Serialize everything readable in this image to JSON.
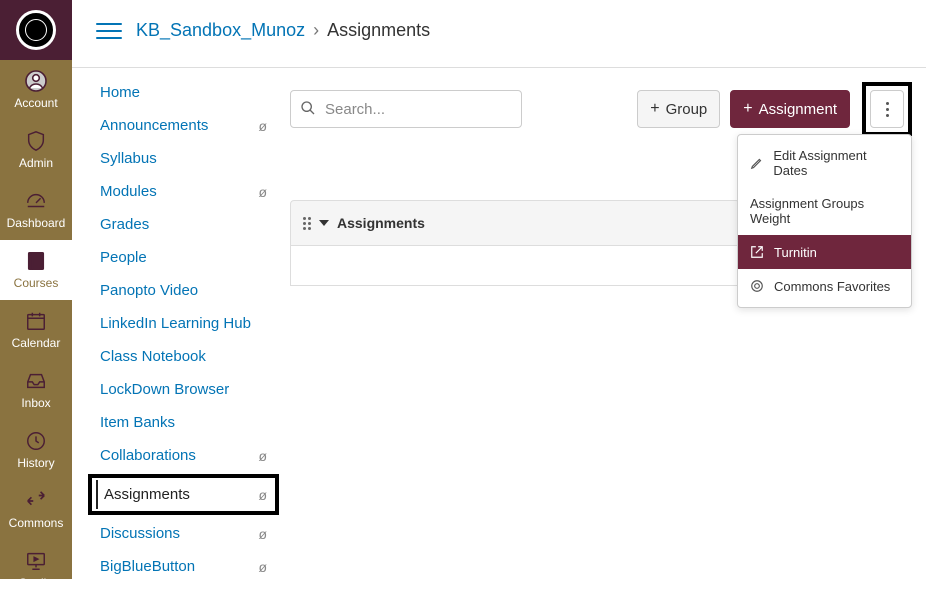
{
  "global_nav": {
    "items": [
      {
        "id": "account",
        "label": "Account"
      },
      {
        "id": "admin",
        "label": "Admin"
      },
      {
        "id": "dashboard",
        "label": "Dashboard"
      },
      {
        "id": "courses",
        "label": "Courses"
      },
      {
        "id": "calendar",
        "label": "Calendar"
      },
      {
        "id": "inbox",
        "label": "Inbox"
      },
      {
        "id": "history",
        "label": "History"
      },
      {
        "id": "commons",
        "label": "Commons"
      },
      {
        "id": "studio",
        "label": "Studio"
      }
    ],
    "active": "courses"
  },
  "breadcrumb": {
    "course": "KB_Sandbox_Munoz",
    "separator": "›",
    "page": "Assignments"
  },
  "course_nav": {
    "items": [
      {
        "label": "Home",
        "hidden": false
      },
      {
        "label": "Announcements",
        "hidden": true
      },
      {
        "label": "Syllabus",
        "hidden": false
      },
      {
        "label": "Modules",
        "hidden": true
      },
      {
        "label": "Grades",
        "hidden": false
      },
      {
        "label": "People",
        "hidden": false
      },
      {
        "label": "Panopto Video",
        "hidden": false
      },
      {
        "label": "LinkedIn Learning Hub",
        "hidden": false
      },
      {
        "label": "Class Notebook",
        "hidden": false
      },
      {
        "label": "LockDown Browser",
        "hidden": false
      },
      {
        "label": "Item Banks",
        "hidden": false
      },
      {
        "label": "Collaborations",
        "hidden": true
      },
      {
        "label": "Assignments",
        "hidden": true,
        "active": true,
        "boxed": true
      },
      {
        "label": "Discussions",
        "hidden": true
      },
      {
        "label": "BigBlueButton",
        "hidden": true
      }
    ]
  },
  "toolbar": {
    "search_placeholder": "Search...",
    "group_button": "Group",
    "assignment_button": "Assignment"
  },
  "group_header": {
    "title": "Assignments"
  },
  "kebab_menu": {
    "items": [
      {
        "label": "Edit Assignment Dates",
        "icon": "pencil"
      },
      {
        "label": "Assignment Groups Weight",
        "icon": ""
      },
      {
        "label": "Turnitin",
        "icon": "export",
        "hover": true
      },
      {
        "label": "Commons Favorites",
        "icon": "commons"
      }
    ]
  }
}
